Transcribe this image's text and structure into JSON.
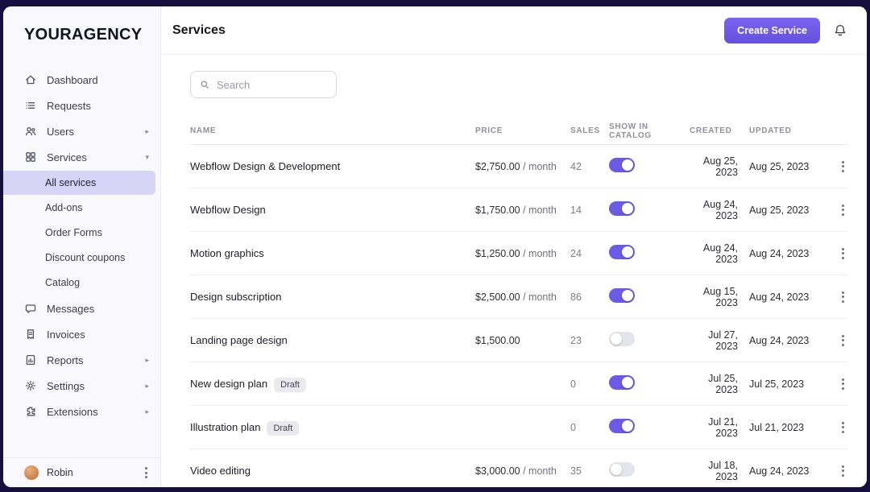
{
  "colors": {
    "accent": "#6c5ce7",
    "toggle_on": "#6a5ae4",
    "toggle_off": "#e4e4ec",
    "active_item_bg": "#d8d4f7",
    "frame_bg": "#170f3d"
  },
  "brand": {
    "logo": "YOURAGENCY"
  },
  "sidebar": {
    "items": [
      {
        "label": "Dashboard",
        "icon": "home-icon"
      },
      {
        "label": "Requests",
        "icon": "requests-icon"
      },
      {
        "label": "Users",
        "icon": "users-icon",
        "chevron": "right"
      },
      {
        "label": "Services",
        "icon": "services-grid-icon",
        "chevron": "down"
      },
      {
        "label": "Messages",
        "icon": "messages-icon"
      },
      {
        "label": "Invoices",
        "icon": "invoices-icon"
      },
      {
        "label": "Reports",
        "icon": "reports-icon",
        "chevron": "right"
      },
      {
        "label": "Settings",
        "icon": "settings-gear-icon",
        "chevron": "right"
      },
      {
        "label": "Extensions",
        "icon": "extensions-icon",
        "chevron": "right"
      }
    ],
    "chevron_right_glyph": "▸",
    "chevron_down_glyph": "▾",
    "services_subitems": [
      {
        "label": "All services",
        "active": true
      },
      {
        "label": "Add-ons",
        "active": false
      },
      {
        "label": "Order Forms",
        "active": false
      },
      {
        "label": "Discount coupons",
        "active": false
      },
      {
        "label": "Catalog",
        "active": false
      }
    ],
    "user": {
      "name": "Robin"
    }
  },
  "header": {
    "title": "Services",
    "create_button_label": "Create Service"
  },
  "search": {
    "placeholder": "Search"
  },
  "table": {
    "columns": {
      "name": "NAME",
      "price": "PRICE",
      "sales": "SALES",
      "catalog": "SHOW IN CATALOG",
      "created": "CREATED",
      "updated": "UPDATED"
    },
    "rows": [
      {
        "name": "Webflow Design & Development",
        "badge": "",
        "price": "$2,750.00",
        "period": "/ month",
        "sales": "42",
        "show_in_catalog": true,
        "created": "Aug 25, 2023",
        "updated": "Aug 25, 2023"
      },
      {
        "name": "Webflow Design",
        "badge": "",
        "price": "$1,750.00",
        "period": "/ month",
        "sales": "14",
        "show_in_catalog": true,
        "created": "Aug 24, 2023",
        "updated": "Aug 25, 2023"
      },
      {
        "name": "Motion graphics",
        "badge": "",
        "price": "$1,250.00",
        "period": "/ month",
        "sales": "24",
        "show_in_catalog": true,
        "created": "Aug 24, 2023",
        "updated": "Aug 24, 2023"
      },
      {
        "name": "Design subscription",
        "badge": "",
        "price": "$2,500.00",
        "period": "/ month",
        "sales": "86",
        "show_in_catalog": true,
        "created": "Aug 15, 2023",
        "updated": "Aug 24, 2023"
      },
      {
        "name": "Landing page design",
        "badge": "",
        "price": "$1,500.00",
        "period": "",
        "sales": "23",
        "show_in_catalog": false,
        "created": "Jul 27, 2023",
        "updated": "Aug 24, 2023"
      },
      {
        "name": "New design plan",
        "badge": "Draft",
        "price": "",
        "period": "",
        "sales": "0",
        "show_in_catalog": true,
        "created": "Jul 25, 2023",
        "updated": "Jul 25, 2023"
      },
      {
        "name": "Illustration plan",
        "badge": "Draft",
        "price": "",
        "period": "",
        "sales": "0",
        "show_in_catalog": true,
        "created": "Jul 21, 2023",
        "updated": "Jul 21, 2023"
      },
      {
        "name": "Video editing",
        "badge": "",
        "price": "$3,000.00",
        "period": "/ month",
        "sales": "35",
        "show_in_catalog": false,
        "created": "Jul 18, 2023",
        "updated": "Aug 24, 2023"
      }
    ]
  }
}
